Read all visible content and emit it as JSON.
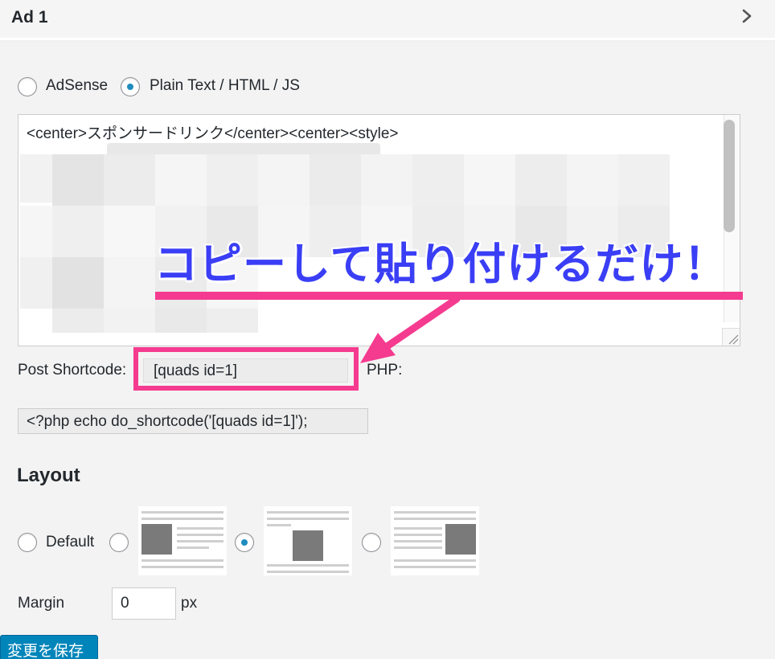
{
  "panel": {
    "title": "Ad 1",
    "chevron_icon": "chevron-right-icon"
  },
  "ad_type": {
    "options": [
      {
        "label": "AdSense",
        "checked": false
      },
      {
        "label": "Plain Text / HTML / JS",
        "checked": true
      }
    ]
  },
  "code": {
    "first_line": "<center>スポンサードリンク</center><center><style>"
  },
  "annotation": {
    "text": "コピーして貼り付けるだけ！",
    "color": "#3a3ef5",
    "accent": "#f53b8f"
  },
  "shortcode": {
    "label": "Post Shortcode:",
    "value": "[quads id=1]",
    "php_label": "PHP:",
    "php_value": "<?php echo do_shortcode('[quads id=1]');"
  },
  "layout": {
    "title": "Layout",
    "default_label": "Default",
    "selected": "center"
  },
  "margin": {
    "label": "Margin",
    "value": "0",
    "unit": "px"
  },
  "save": {
    "label": "変更を保存",
    "color": "#0085ba"
  }
}
